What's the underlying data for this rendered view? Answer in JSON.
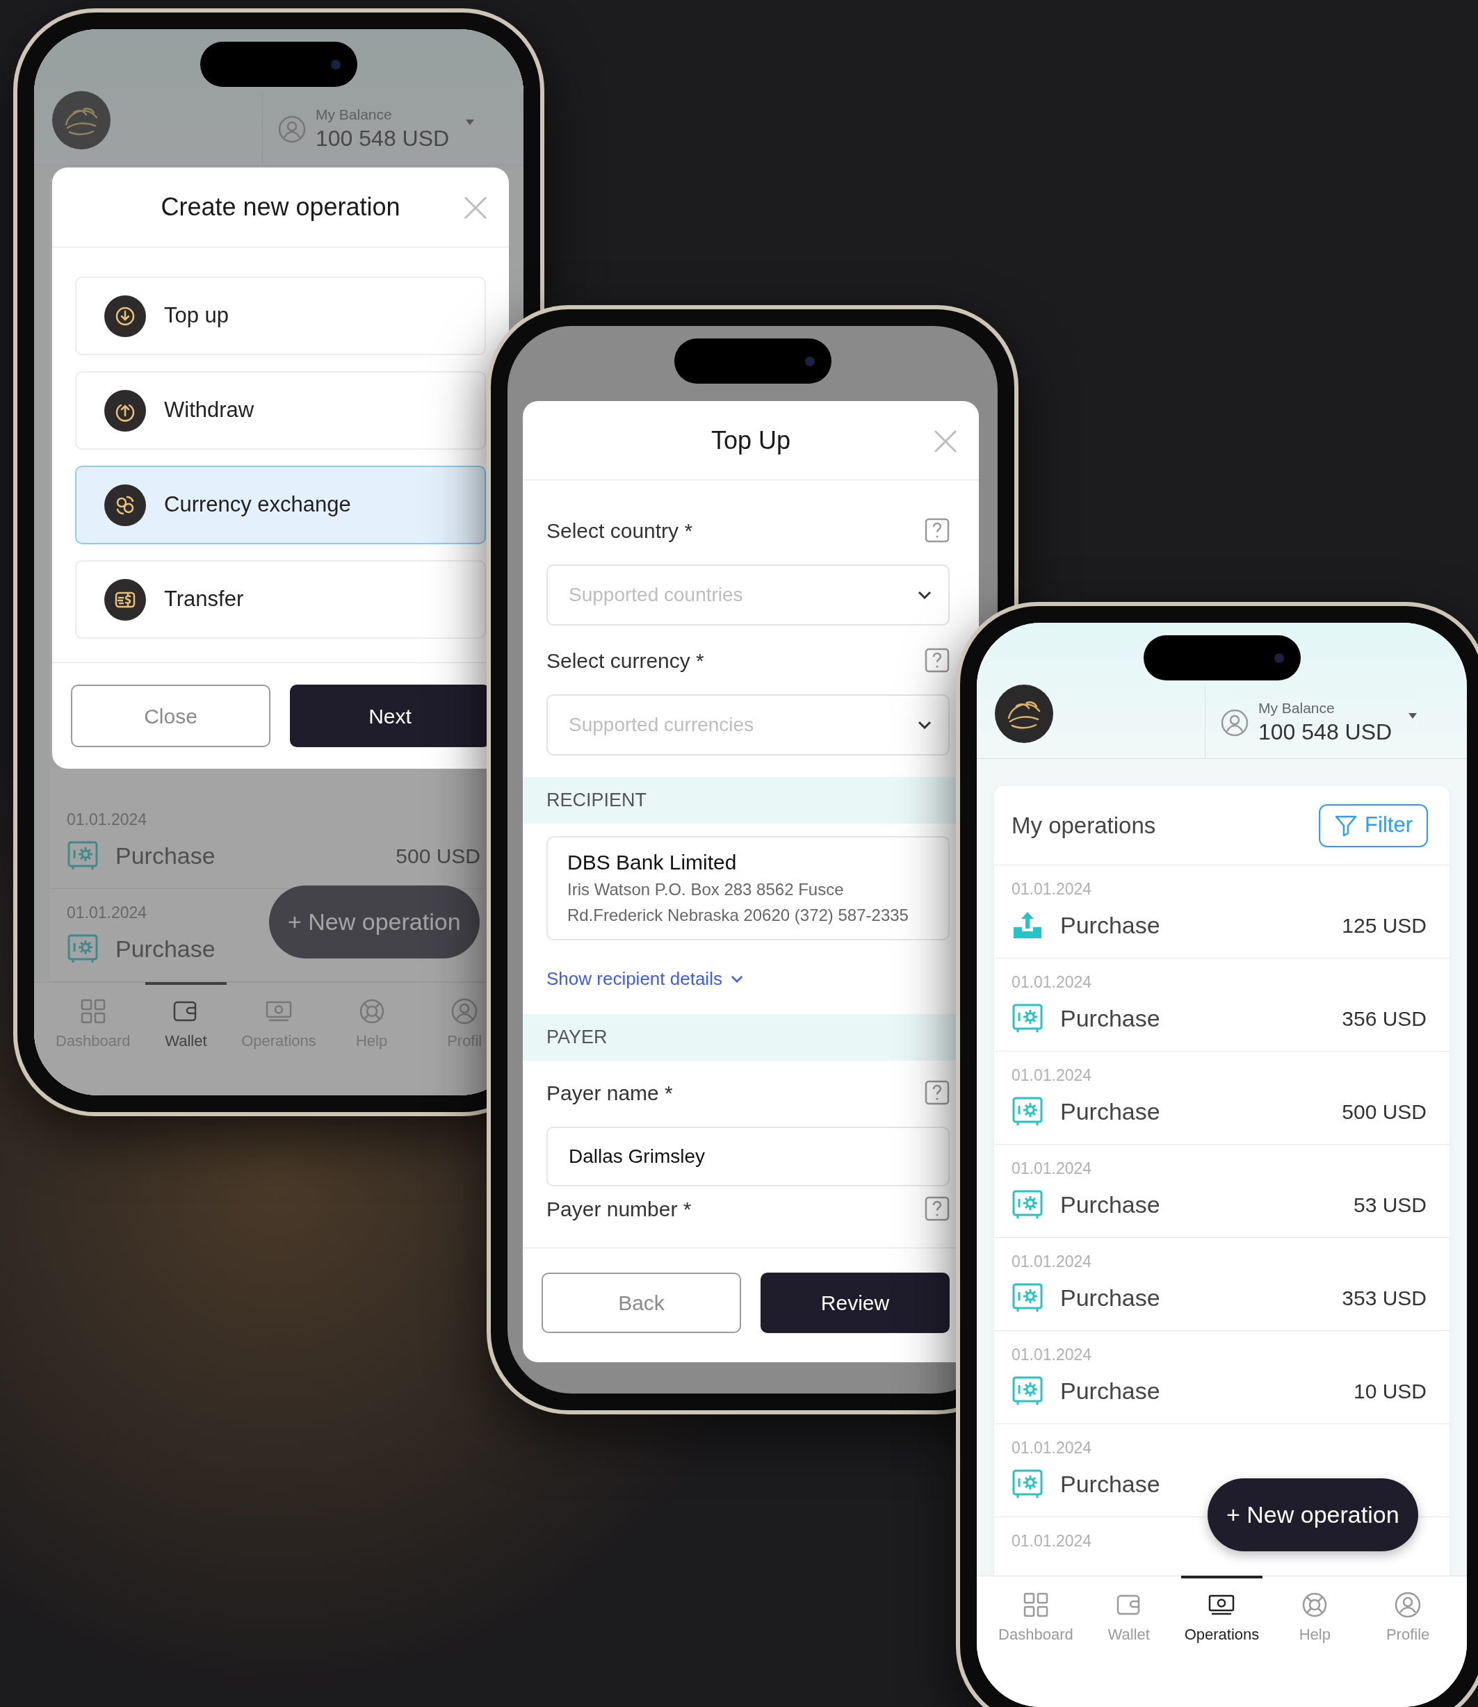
{
  "left_phone": {
    "balance_label": "My Balance",
    "balance_amount": "100 548 USD",
    "operations": [
      {
        "kind": "safe",
        "date": "01.01.2024",
        "title": "Purchase",
        "amount": "500 USD"
      },
      {
        "kind": "safe",
        "date": "01.01.2024",
        "title": "Purchase"
      }
    ],
    "new_operation_button": "+ New operation",
    "nav": [
      {
        "label": "Dashboard",
        "selected": false
      },
      {
        "label": "Wallet",
        "selected": true
      },
      {
        "label": "Operations",
        "selected": false
      },
      {
        "label": "Help",
        "selected": false
      },
      {
        "label": "Profil",
        "selected": false
      }
    ],
    "modal": {
      "title": "Create new operation",
      "options": [
        {
          "label": "Top up",
          "selected": false
        },
        {
          "label": "Withdraw",
          "selected": false
        },
        {
          "label": "Currency exchange",
          "selected": true
        },
        {
          "label": "Transfer",
          "selected": false
        }
      ],
      "buttons": [
        {
          "label": "Close",
          "kind": "secondary"
        },
        {
          "label": "Next",
          "kind": "primary"
        }
      ]
    }
  },
  "middle_phone": {
    "modal": {
      "title": "Top Up",
      "fields": [
        {
          "kind": "select",
          "label": "Select country *",
          "placeholder": "Supported countries"
        },
        {
          "kind": "select",
          "label": "Select currency *",
          "placeholder": "Supported currencies"
        },
        {
          "kind": "section",
          "label": "RECIPIENT"
        },
        {
          "kind": "recipient",
          "name": "DBS Bank Limited",
          "address": "Iris Watson P.O. Box 283 8562 Fusce Rd.Frederick Nebraska 20620 (372) 587-2335"
        },
        {
          "kind": "link",
          "label": "Show recipient details"
        },
        {
          "kind": "section",
          "label": "PAYER"
        },
        {
          "kind": "text",
          "label": "Payer name *",
          "value": "Dallas Grimsley"
        },
        {
          "kind": "label",
          "label": "Payer number *"
        }
      ],
      "buttons": [
        {
          "label": "Back",
          "kind": "secondary"
        },
        {
          "label": "Review",
          "kind": "primary"
        }
      ]
    }
  },
  "right_phone": {
    "balance_label": "My Balance",
    "balance_amount": "100 548 USD",
    "title": "My operations",
    "filter_button": "Filter",
    "operations": [
      {
        "kind": "upload",
        "date": "01.01.2024",
        "title": "Purchase",
        "amount": "125 USD"
      },
      {
        "kind": "safe",
        "date": "01.01.2024",
        "title": "Purchase",
        "amount": "356 USD"
      },
      {
        "kind": "safe",
        "date": "01.01.2024",
        "title": "Purchase",
        "amount": "500 USD"
      },
      {
        "kind": "safe",
        "date": "01.01.2024",
        "title": "Purchase",
        "amount": "53 USD"
      },
      {
        "kind": "safe",
        "date": "01.01.2024",
        "title": "Purchase",
        "amount": "353 USD"
      },
      {
        "kind": "safe",
        "date": "01.01.2024",
        "title": "Purchase",
        "amount": "10 USD"
      },
      {
        "kind": "safe",
        "date": "01.01.2024",
        "title": "Purchase"
      },
      {
        "date": "01.01.2024"
      }
    ],
    "new_operation_button": "+ New operation",
    "nav": [
      {
        "label": "Dashboard",
        "selected": false
      },
      {
        "label": "Wallet",
        "selected": false
      },
      {
        "label": "Operations",
        "selected": true
      },
      {
        "label": "Help",
        "selected": false
      },
      {
        "label": "Profile",
        "selected": false
      }
    ]
  }
}
